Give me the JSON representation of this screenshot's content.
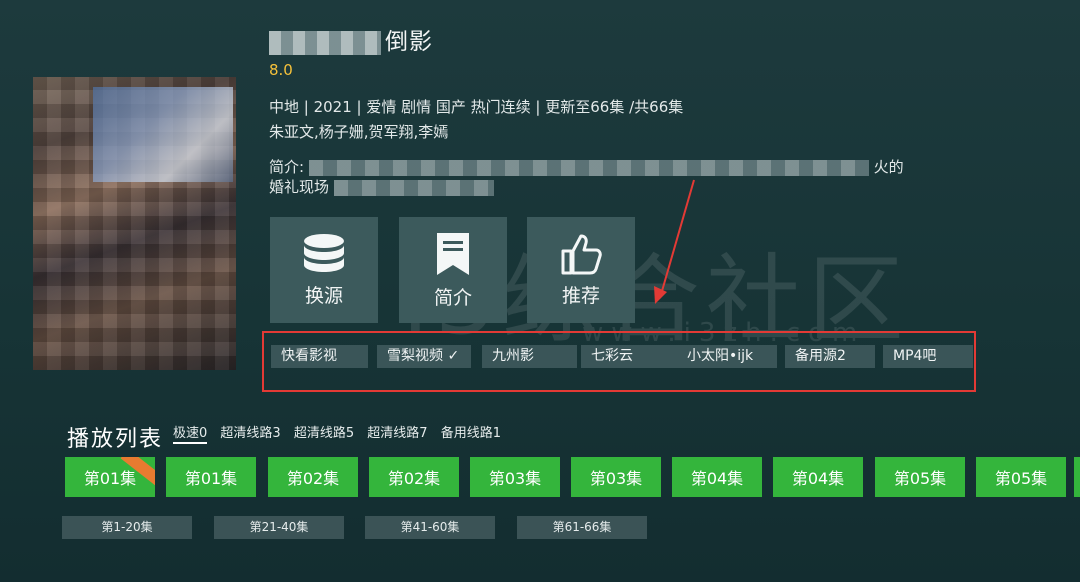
{
  "detail": {
    "title_visible": "倒影",
    "score": "8.0",
    "meta_line": "中地 | 2021 | 爱情 剧情 国产 热门连续 | 更新至66集 /共66集",
    "cast": "朱亚文,杨子姗,贺军翔,李嫣",
    "desc_prefix": "简介:",
    "desc_suffix": "火的",
    "desc_line2_prefix": "婚礼现场"
  },
  "actions": [
    {
      "label": "换源",
      "icon": "database-icon"
    },
    {
      "label": "简介",
      "icon": "bookmark-icon"
    },
    {
      "label": "推荐",
      "icon": "thumbs-up-icon"
    }
  ],
  "sources": [
    {
      "label": "快看影视"
    },
    {
      "label": "雪梨视频 ✓"
    },
    {
      "label": "九州影"
    },
    {
      "label": "七彩云"
    },
    {
      "label": "小太阳•ijk"
    },
    {
      "label": "备用源2"
    },
    {
      "label": "MP4吧"
    }
  ],
  "playlist": {
    "title": "播放列表",
    "lines": [
      "极速0",
      "超清线路3",
      "超清线路5",
      "超清线路7",
      "备用线路1"
    ],
    "active_line": "极速0",
    "episodes": [
      "第01集",
      "第01集",
      "第02集",
      "第02集",
      "第03集",
      "第03集",
      "第04集",
      "第04集",
      "第05集",
      "第05集"
    ],
    "ranges": [
      "第1-20集",
      "第21-40集",
      "第41-60集",
      "第61-66集"
    ]
  },
  "watermark": {
    "text": "i3综合社区",
    "url": "www.i3zh.com"
  },
  "colors": {
    "accent_green": "#34b53c",
    "highlight_red": "#e33a35",
    "score_yellow": "#f5c13b",
    "background": "#173436"
  }
}
